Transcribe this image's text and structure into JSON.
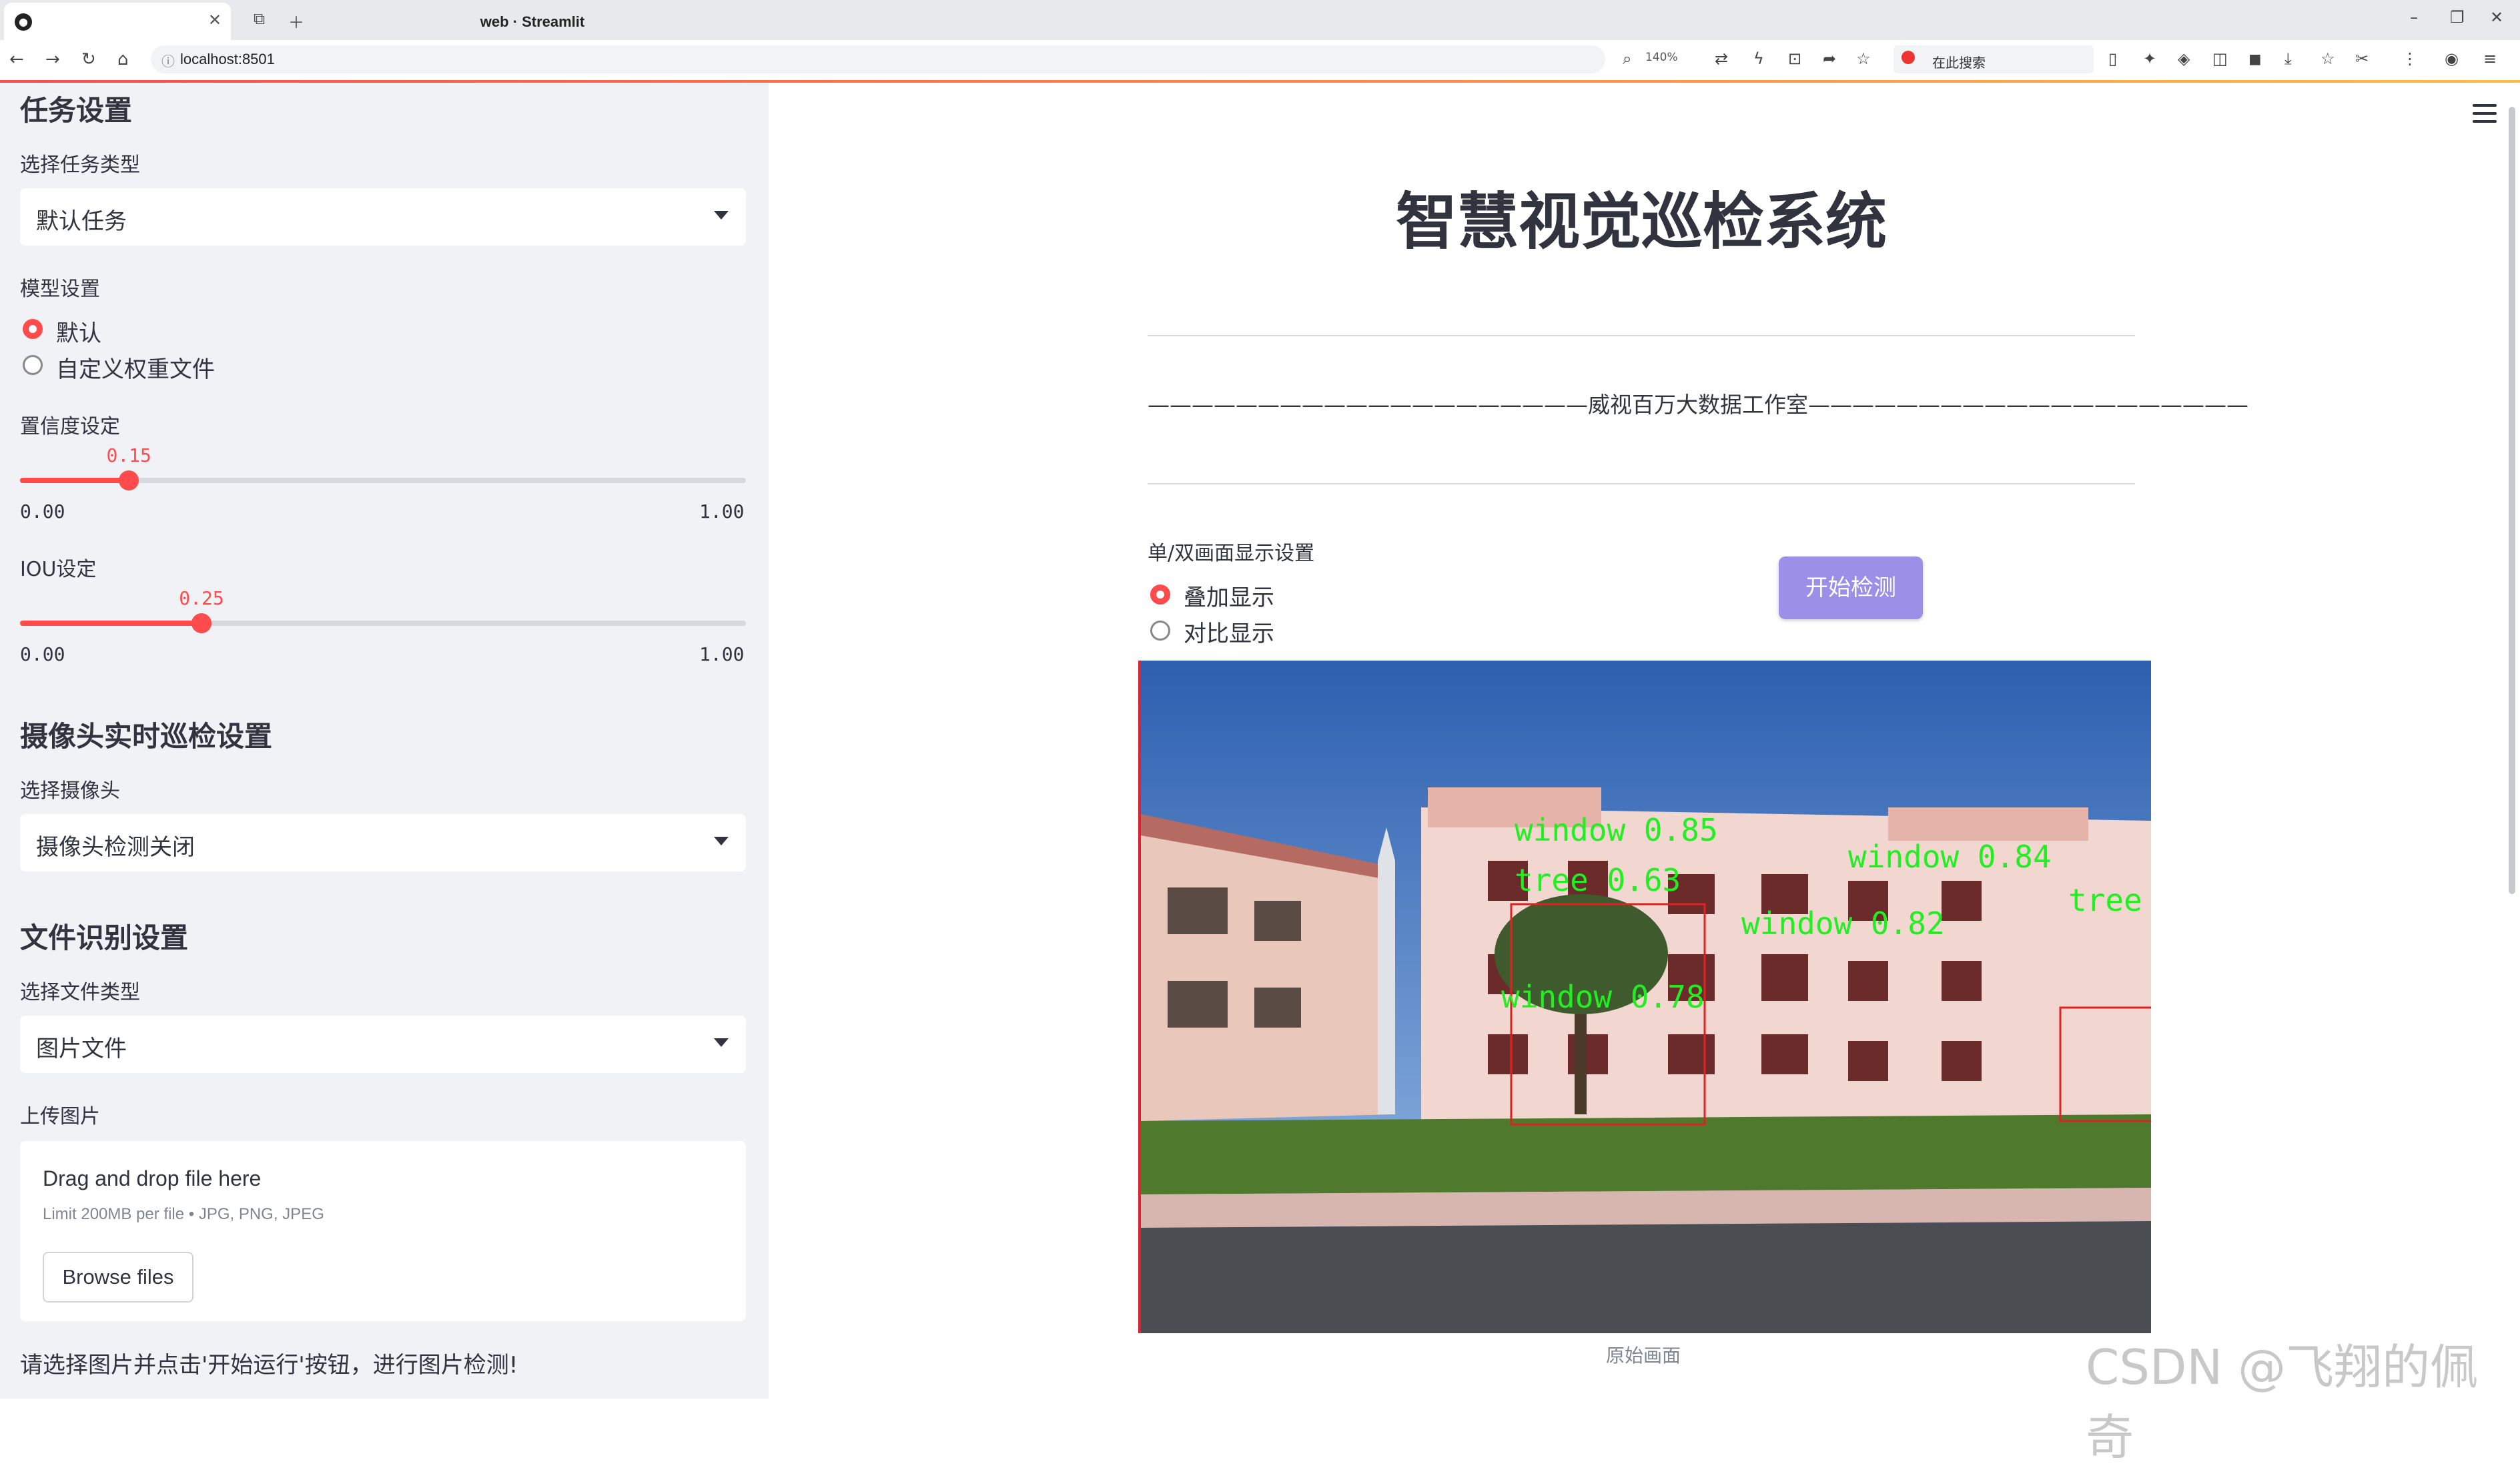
{
  "browser": {
    "tab_title": "web · Streamlit",
    "url": "localhost:8501",
    "zoom": "140%",
    "search_placeholder": "在此搜索"
  },
  "sidebar": {
    "task_header": "任务设置",
    "task_type_label": "选择任务类型",
    "task_type_value": "默认任务",
    "model_label": "模型设置",
    "model_options": [
      "默认",
      "自定义权重文件"
    ],
    "conf_label": "置信度设定",
    "conf_value": "0.15",
    "conf_fraction": 0.15,
    "conf_min": "0.00",
    "conf_max": "1.00",
    "iou_label": "IOU设定",
    "iou_value": "0.25",
    "iou_fraction": 0.25,
    "iou_min": "0.00",
    "iou_max": "1.00",
    "camera_header": "摄像头实时巡检设置",
    "camera_label": "选择摄像头",
    "camera_value": "摄像头检测关闭",
    "file_header": "文件识别设置",
    "file_type_label": "选择文件类型",
    "file_type_value": "图片文件",
    "upload_label": "上传图片",
    "upload_drag": "Drag and drop file here",
    "upload_limit": "Limit 200MB per file • JPG, PNG, JPEG",
    "browse_button": "Browse files",
    "hint": "请选择图片并点击'开始运行'按钮，进行图片检测!"
  },
  "main": {
    "title": "智慧视觉巡检系统",
    "studio": "————————————————————威视百万大数据工作室————————————————————",
    "display_label": "单/双画面显示设置",
    "display_options": [
      "叠加显示",
      "对比显示"
    ],
    "start_button": "开始检测",
    "caption": "原始画面",
    "detections": [
      "window 0.85",
      "window 0.84",
      "window 0.82",
      "window 0.78",
      "tree 0.63",
      "tree"
    ]
  },
  "watermark": "CSDN @飞翔的佩奇"
}
